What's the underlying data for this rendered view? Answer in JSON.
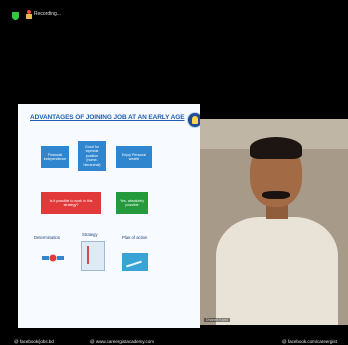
{
  "topbar": {
    "status": "Recording..."
  },
  "slide": {
    "title": "ADVANTAGES OF JOINING JOB AT AN EARLY AGE",
    "boxes": [
      "Financial independence",
      "Good for topmost position (home-hierarchal)",
      "Enjoy Personal wealth",
      "Is it possible to work in this strategy?",
      "Yes, absolutely possible"
    ],
    "labels": [
      "Determination",
      "Strategy",
      "Plan of action"
    ]
  },
  "webcam": {
    "name": "Dhanek Karki"
  },
  "footer": {
    "left": "@ facebook/jobs.bd",
    "center": "@ www.careergistacademy.com",
    "right": "@ facebook.com/careergist"
  },
  "colors": {
    "blue": "#2f86cf",
    "red": "#e23a3a",
    "green": "#249a3c",
    "title": "#1f5fb2"
  }
}
